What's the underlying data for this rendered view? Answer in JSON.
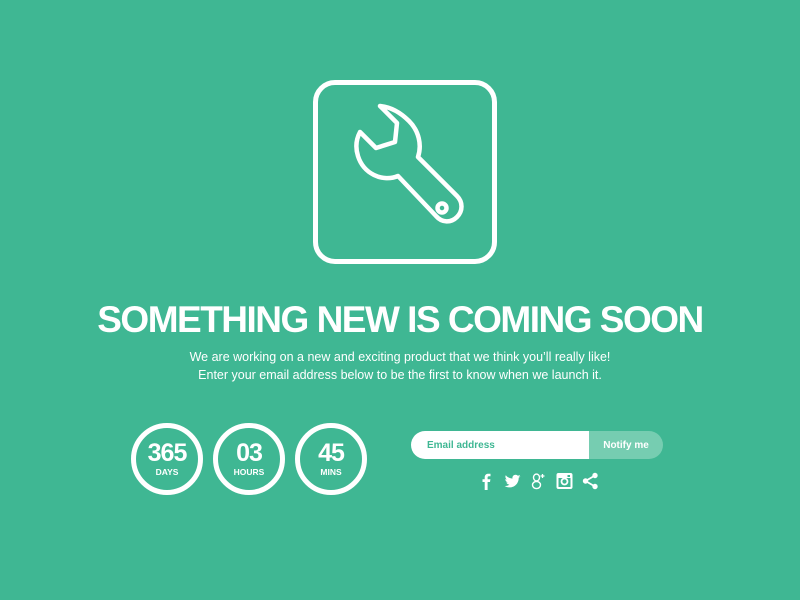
{
  "logo": {
    "icon": "wrench-icon"
  },
  "headline": "SOMETHING NEW IS COMING SOON",
  "subtext": {
    "line1": "We are working on a new and exciting product that we think you’ll really like!",
    "line2": "Enter your email address below to be the first to know when we launch it."
  },
  "countdown": [
    {
      "value": "365",
      "unit": "DAYS"
    },
    {
      "value": "03",
      "unit": "HOURS"
    },
    {
      "value": "45",
      "unit": "MINS"
    }
  ],
  "signup": {
    "email_placeholder": "Email address",
    "email_value": "",
    "button_label": "Notify me"
  },
  "social": [
    {
      "name": "facebook",
      "icon": "facebook-icon"
    },
    {
      "name": "twitter",
      "icon": "twitter-icon"
    },
    {
      "name": "google-plus",
      "icon": "google-plus-icon"
    },
    {
      "name": "instagram",
      "icon": "instagram-icon"
    },
    {
      "name": "share",
      "icon": "share-icon"
    }
  ],
  "colors": {
    "background": "#3fb793",
    "button": "#76cdb1",
    "text": "#ffffff"
  }
}
